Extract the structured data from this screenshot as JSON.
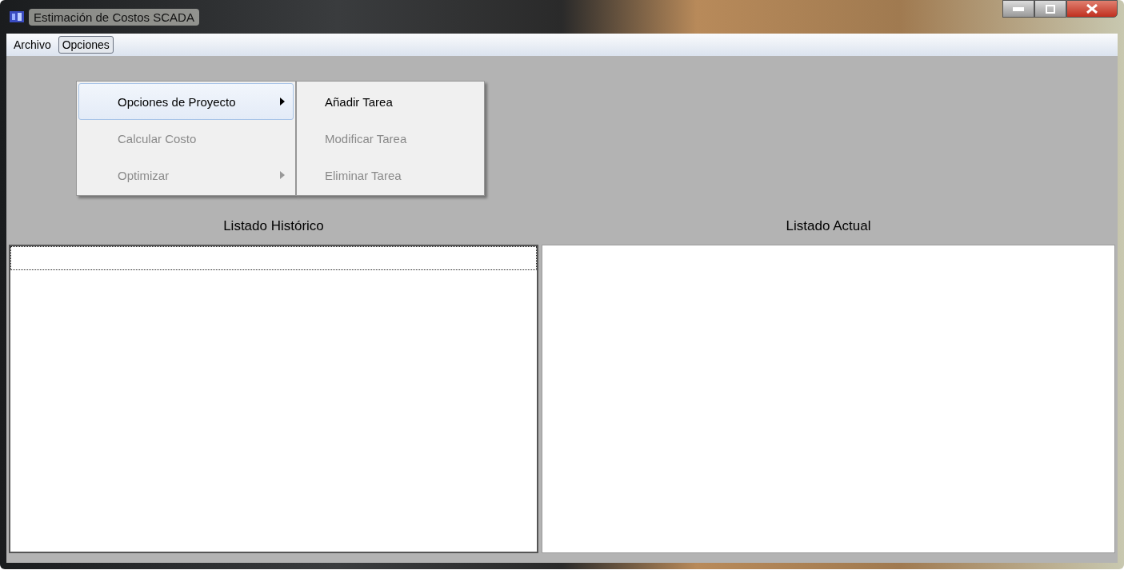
{
  "window": {
    "title": "Estimación de Costos SCADA"
  },
  "menu_bar": [
    {
      "label": "Archivo",
      "selected": false
    },
    {
      "label": "Opciones",
      "selected": true
    }
  ],
  "dropdown": [
    {
      "label": "Opciones de Proyecto",
      "disabled": false,
      "selected": true,
      "has_submenu": true
    },
    {
      "label": "Calcular Costo",
      "disabled": true,
      "selected": false,
      "has_submenu": false
    },
    {
      "label": "Optimizar",
      "disabled": true,
      "selected": false,
      "has_submenu": true
    }
  ],
  "submenu": [
    {
      "label": "Añadir Tarea",
      "disabled": false
    },
    {
      "label": "Modificar Tarea",
      "disabled": true
    },
    {
      "label": "Eliminar Tarea",
      "disabled": true
    }
  ],
  "panels": [
    {
      "title": "Listado Histórico",
      "focused": true
    },
    {
      "title": "Listado Actual",
      "focused": false
    }
  ]
}
